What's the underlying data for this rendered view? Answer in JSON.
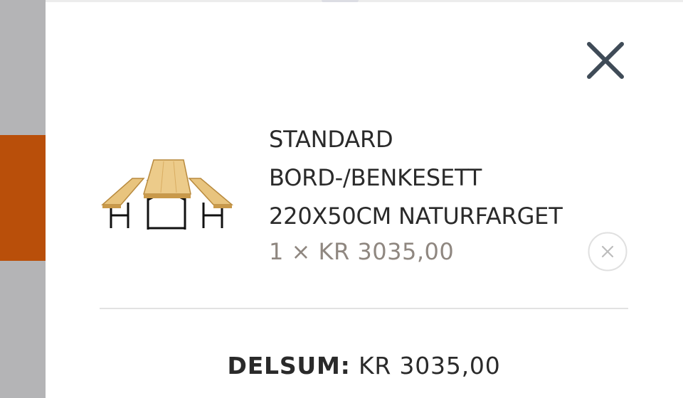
{
  "cart": {
    "close_icon": "close-icon",
    "items": [
      {
        "image_icon": "beer-table-bench-set-image",
        "name": "STANDARD BORD-/BENKESETT 220X50CM NATURFARGET",
        "price_line": "1 × KR 3035,00",
        "remove_icon": "remove-circle-x-icon"
      }
    ],
    "subtotal_label": "DELSUM:",
    "subtotal_value": "KR 3035,00"
  },
  "colors": {
    "backdrop_gray": "#b4b4b6",
    "backdrop_accent": "#b94f0a",
    "close_icon": "#3f4b57",
    "text_primary": "#2a2a2a",
    "text_price": "#8f8780",
    "divider": "#e2e2e2"
  }
}
